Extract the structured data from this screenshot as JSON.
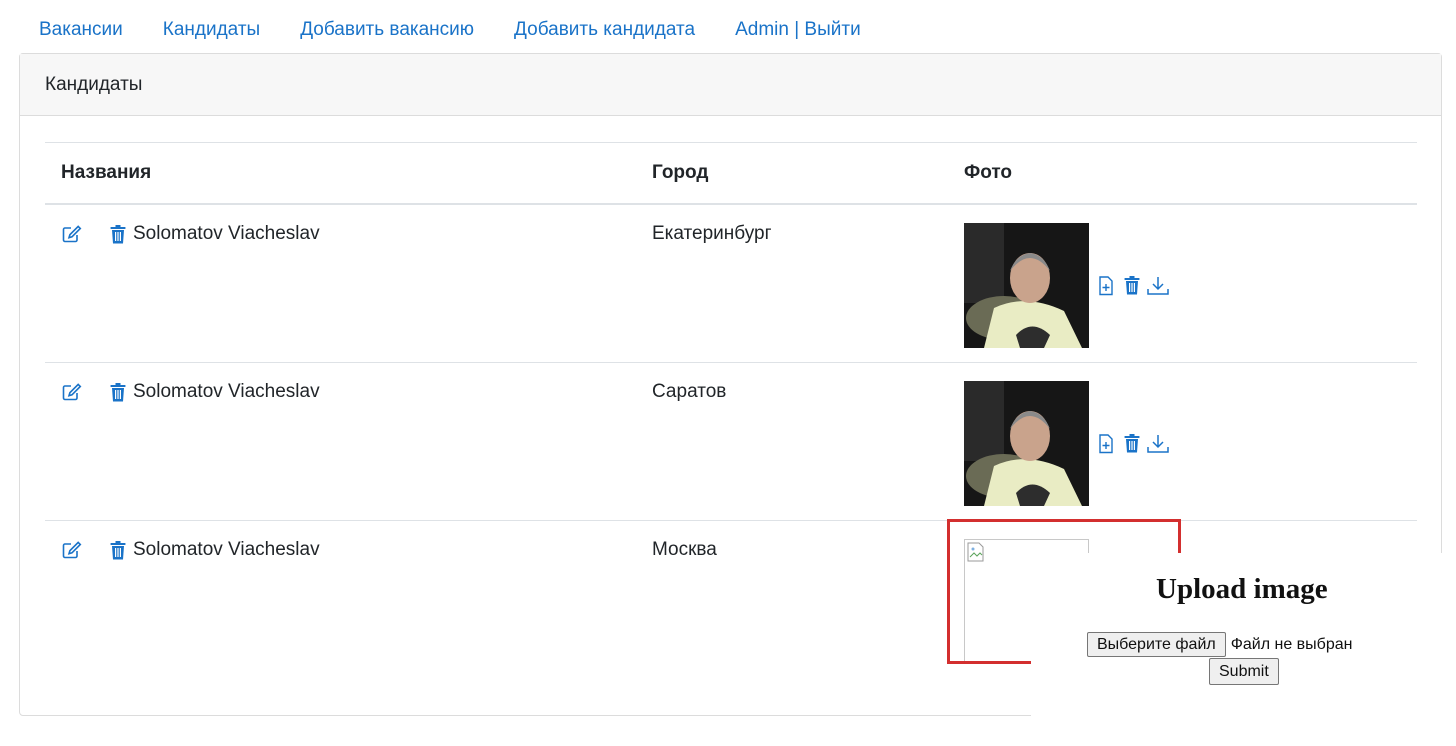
{
  "nav": {
    "items": [
      "Вакансии",
      "Кандидаты",
      "Добавить вакансию",
      "Добавить кандидата",
      "Admin | Выйти"
    ]
  },
  "card": {
    "title": "Кандидаты"
  },
  "table": {
    "headers": [
      "Названия",
      "Город",
      "Фото"
    ],
    "rows": [
      {
        "name": "Solomatov Viacheslav",
        "city": "Екатеринбург",
        "photo": "present"
      },
      {
        "name": "Solomatov Viacheslav",
        "city": "Саратов",
        "photo": "present"
      },
      {
        "name": "Solomatov Viacheslav",
        "city": "Москва",
        "photo": "broken"
      }
    ]
  },
  "icons": {
    "edit": "edit-icon",
    "delete": "trash-icon",
    "add_file": "file-plus-icon",
    "download": "download-icon",
    "broken_image": "broken-image-icon"
  },
  "upload": {
    "title": "Upload image",
    "choose_button": "Выберите файл",
    "no_file_text": "Файл не выбран",
    "submit": "Submit"
  },
  "colors": {
    "link": "#1a73c8",
    "highlight": "#d32f2f",
    "header_bg": "#f7f7f7"
  }
}
